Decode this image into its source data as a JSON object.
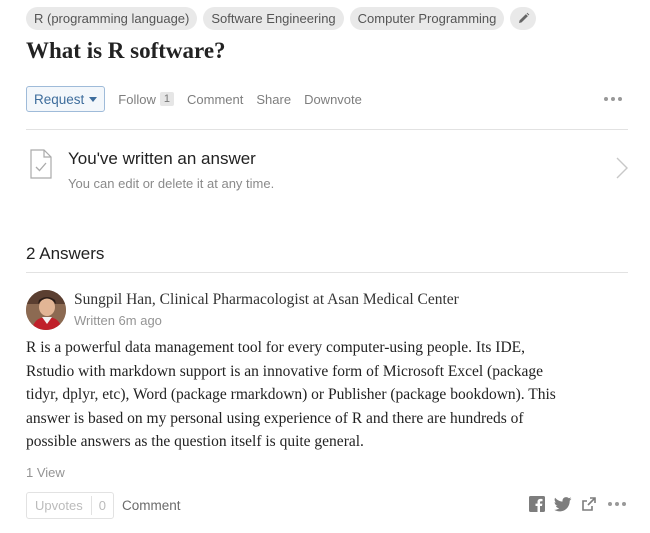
{
  "topics": [
    "R (programming language)",
    "Software Engineering",
    "Computer Programming"
  ],
  "question": {
    "title": "What is R software?"
  },
  "actions": {
    "request": "Request",
    "follow": "Follow",
    "follow_count": "1",
    "comment": "Comment",
    "share": "Share",
    "downvote": "Downvote"
  },
  "written_notice": {
    "title": "You've written an answer",
    "subtitle": "You can edit or delete it at any time."
  },
  "answers_header": "2 Answers",
  "answer": {
    "author": "Sungpil Han, Clinical Pharmacologist at Asan Medical Center",
    "time": "Written 6m ago",
    "lines": [
      "R is a powerful data management tool for every computer-using people. Its IDE,",
      "Rstudio with markdown support is an innovative form of Microsoft Excel (package",
      "tidyr, dplyr, etc), Word (package rmarkdown) or Publisher (package bookdown). This",
      "answer is based on my personal using experience of R and there are hundreds of",
      "possible answers as the question itself is quite general."
    ],
    "views": "1 View",
    "upvotes_label": "Upvotes",
    "upvotes_count": "0",
    "comment": "Comment"
  },
  "icons": [
    "pencil-icon",
    "chevron-down-icon",
    "document-check-icon",
    "chevron-right-icon",
    "facebook-icon",
    "twitter-icon",
    "share-icon",
    "more-dots-icon"
  ],
  "colors": {
    "accent": "#3e6d9c",
    "chip_bg": "#e9e9e9",
    "divider": "#e2e2e2"
  }
}
